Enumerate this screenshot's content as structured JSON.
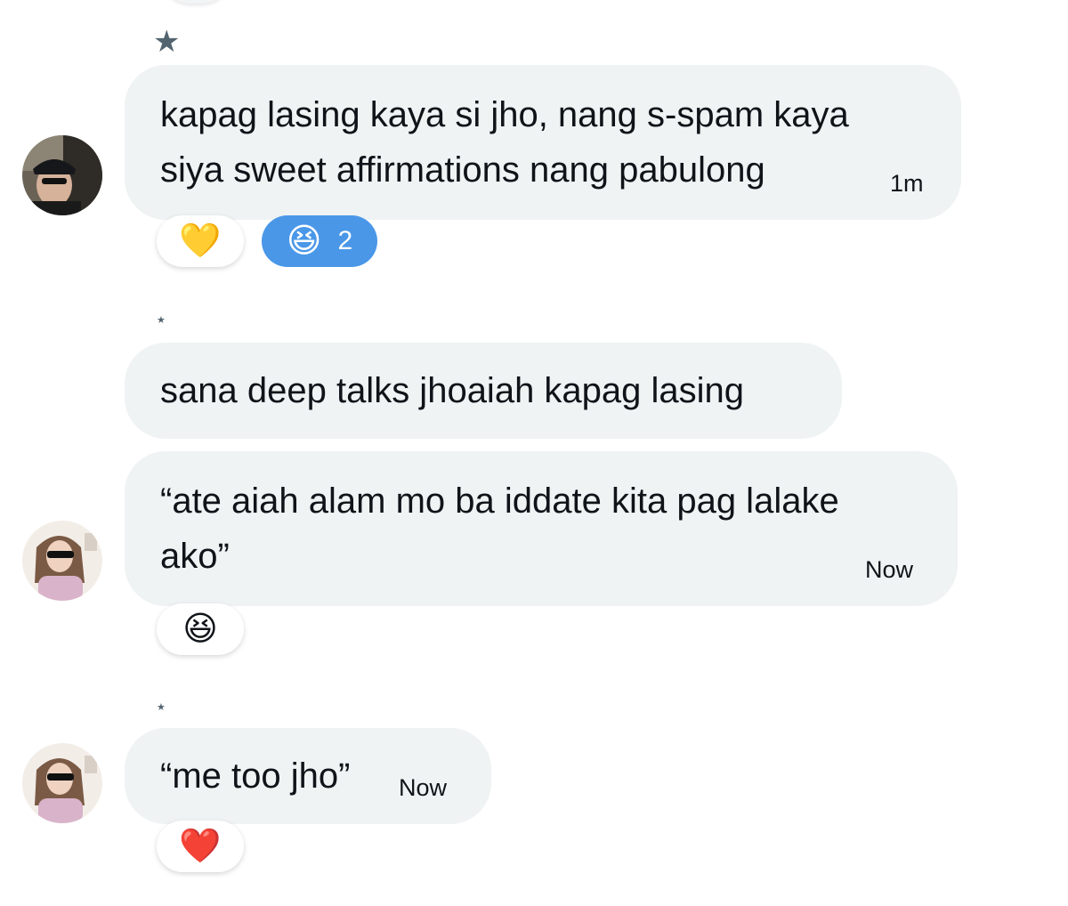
{
  "messages": [
    {
      "text": "kapag lasing kaya si jho, nang s-spam kaya\nsiya sweet affirmations nang pabulong",
      "time": "1m",
      "avatar": "avatar-black-cap",
      "reactions": [
        {
          "emoji": "💛",
          "count": "",
          "active": false
        },
        {
          "emoji": "😆",
          "count": "2",
          "active": true
        }
      ]
    },
    {
      "text": "sana deep talks jhoaiah kapag lasing",
      "time": "",
      "avatar": "",
      "reactions": []
    },
    {
      "text": "“ate aiah alam mo ba iddate kita pag lalake\nako”",
      "time": "Now",
      "avatar": "avatar-sunglasses",
      "reactions": [
        {
          "emoji": "😆",
          "count": "",
          "active": false
        }
      ]
    },
    {
      "text": "“me too jho”",
      "time": "Now",
      "avatar": "avatar-sunglasses",
      "reactions": [
        {
          "emoji": "❤️",
          "count": "",
          "active": false
        }
      ]
    }
  ],
  "colors": {
    "bubble": "#eff3f4",
    "active_reaction": "#4a97e8",
    "star": "#536471"
  }
}
